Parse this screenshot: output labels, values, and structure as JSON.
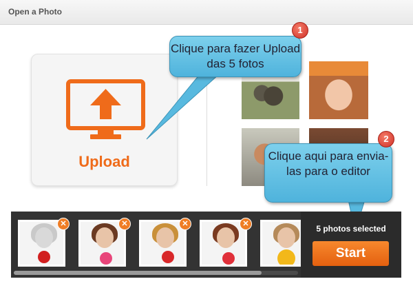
{
  "window": {
    "title": "Open a Photo"
  },
  "upload": {
    "label": "Upload",
    "icon": "monitor-upload-icon",
    "accent": "#ef6b1a"
  },
  "callouts": [
    {
      "number": "1",
      "text": "Clique para fazer Upload das 5 fotos"
    },
    {
      "number": "2",
      "text": "Clique aqui para envia-las para o editor"
    }
  ],
  "selected": {
    "count_label": "5 photos selected",
    "start_label": "Start",
    "remove_icon": "close-icon",
    "remove_glyph": "✕"
  }
}
